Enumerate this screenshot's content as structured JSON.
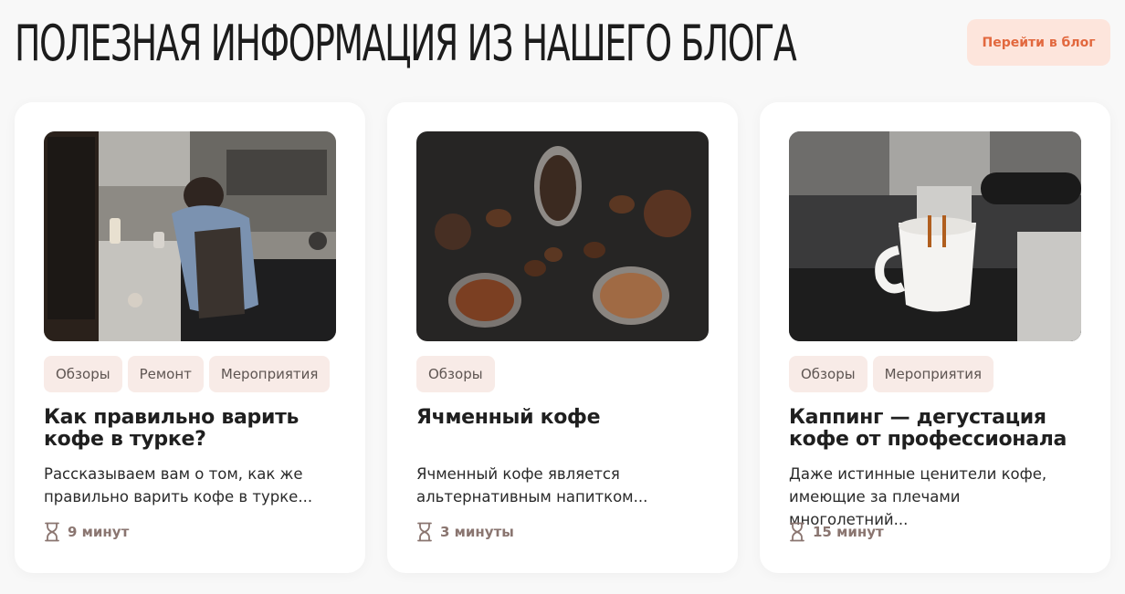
{
  "header": {
    "title": "Полезная информация из нашего блога",
    "blog_button": "Перейти в блог"
  },
  "colors": {
    "accent": "#e2683e",
    "accent_bg": "#fde5dc",
    "tag_bg": "#f8ebe7",
    "meta_text": "#8a7570"
  },
  "cards": [
    {
      "tags": [
        "Обзоры",
        "Ремонт",
        "Мероприятия"
      ],
      "title": "Как правильно варить кофе в турке?",
      "excerpt": "Рассказываем вам о том, как же правильно варить кофе в турке...",
      "read_time": "9 минут",
      "icon": "hourglass-icon"
    },
    {
      "tags": [
        "Обзоры"
      ],
      "title": "Ячменный кофе",
      "excerpt": "Ячменный кофе является альтернативным напитком...",
      "read_time": "3 минуты",
      "icon": "hourglass-icon"
    },
    {
      "tags": [
        "Обзоры",
        "Мероприятия"
      ],
      "title": "Каппинг — дегустация кофе от профессионала",
      "excerpt": "Даже истинные ценители кофе, имеющие за плечами многолетний...",
      "read_time": "15 минут",
      "icon": "hourglass-icon"
    }
  ]
}
